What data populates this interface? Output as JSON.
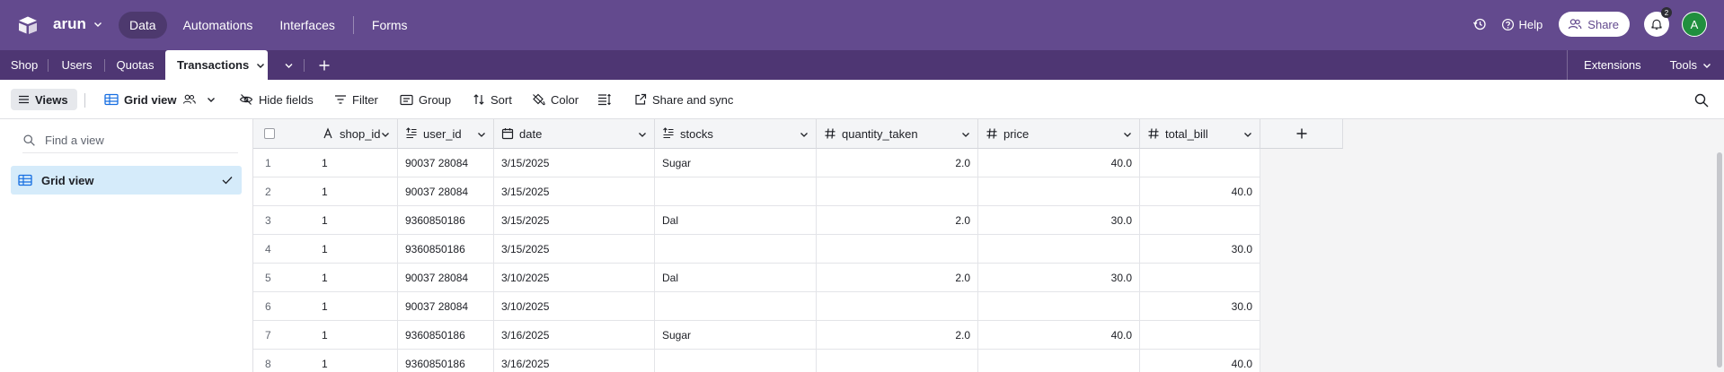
{
  "header": {
    "base_name": "arun",
    "nav": [
      {
        "label": "Data",
        "active": true
      },
      {
        "label": "Automations",
        "active": false
      },
      {
        "label": "Interfaces",
        "active": false
      },
      {
        "label": "Forms",
        "active": false
      }
    ],
    "help_label": "Help",
    "share_label": "Share",
    "notification_count": "2",
    "avatar_initial": "A",
    "colors": {
      "bar": "#634a8e",
      "tabbar": "#4e3673",
      "avatar": "#208f3e"
    }
  },
  "tabs": {
    "items": [
      "Shop",
      "Users",
      "Quotas",
      "Transactions"
    ],
    "active": "Transactions",
    "extensions_label": "Extensions",
    "tools_label": "Tools"
  },
  "toolbar": {
    "views_label": "Views",
    "grid_view_label": "Grid view",
    "hide_fields_label": "Hide fields",
    "filter_label": "Filter",
    "group_label": "Group",
    "sort_label": "Sort",
    "color_label": "Color",
    "share_sync_label": "Share and sync"
  },
  "sidebar": {
    "find_placeholder": "Find a view",
    "views": [
      {
        "label": "Grid view",
        "selected": true
      }
    ]
  },
  "grid": {
    "columns": [
      {
        "name": "shop_id",
        "icon": "single-line-text-icon",
        "align": "left"
      },
      {
        "name": "user_id",
        "icon": "long-text-icon",
        "align": "left"
      },
      {
        "name": "date",
        "icon": "calendar-icon",
        "align": "left"
      },
      {
        "name": "stocks",
        "icon": "long-text-icon",
        "align": "left"
      },
      {
        "name": "quantity_taken",
        "icon": "number-icon",
        "align": "right"
      },
      {
        "name": "price",
        "icon": "number-icon",
        "align": "right"
      },
      {
        "name": "total_bill",
        "icon": "number-icon",
        "align": "right"
      }
    ],
    "rows": [
      {
        "num": "1",
        "cells": [
          "1",
          "90037 28084",
          "3/15/2025",
          "Sugar",
          "2.0",
          "40.0",
          ""
        ]
      },
      {
        "num": "2",
        "cells": [
          "1",
          "90037 28084",
          "3/15/2025",
          "",
          "",
          "",
          "40.0"
        ]
      },
      {
        "num": "3",
        "cells": [
          "1",
          "9360850186",
          "3/15/2025",
          "Dal",
          "2.0",
          "30.0",
          ""
        ]
      },
      {
        "num": "4",
        "cells": [
          "1",
          "9360850186",
          "3/15/2025",
          "",
          "",
          "",
          "30.0"
        ]
      },
      {
        "num": "5",
        "cells": [
          "1",
          "90037 28084",
          "3/10/2025",
          "Dal",
          "2.0",
          "30.0",
          ""
        ]
      },
      {
        "num": "6",
        "cells": [
          "1",
          "90037 28084",
          "3/10/2025",
          "",
          "",
          "",
          "30.0"
        ]
      },
      {
        "num": "7",
        "cells": [
          "1",
          "9360850186",
          "3/16/2025",
          "Sugar",
          "2.0",
          "40.0",
          ""
        ]
      },
      {
        "num": "8",
        "cells": [
          "1",
          "9360850186",
          "3/16/2025",
          "",
          "",
          "",
          "40.0"
        ]
      }
    ]
  }
}
